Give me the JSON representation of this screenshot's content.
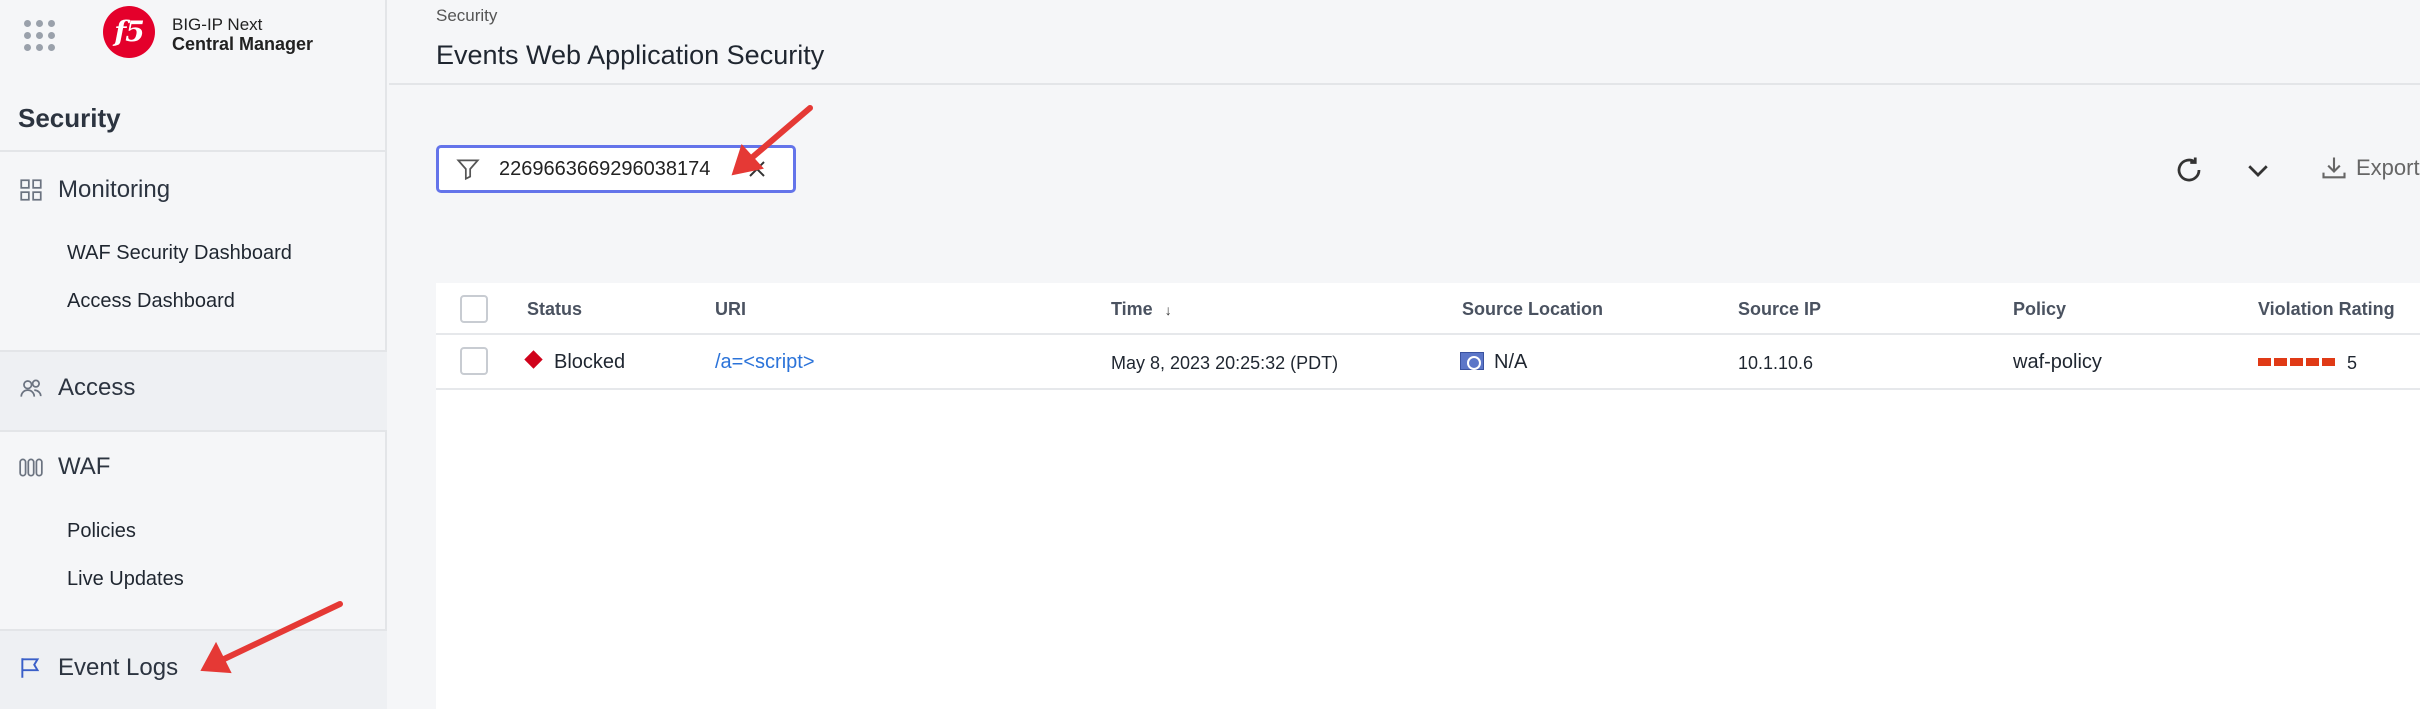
{
  "brand": {
    "line1": "BIG-IP Next",
    "line2": "Central Manager",
    "logo_text": "f5",
    "logo_color": "#e4002b"
  },
  "sidebar": {
    "section_title": "Security",
    "groups": [
      {
        "label": "Monitoring",
        "icon": "grid-icon",
        "items": [
          "WAF Security Dashboard",
          "Access Dashboard"
        ]
      },
      {
        "label": "Access",
        "icon": "users-icon",
        "items": []
      },
      {
        "label": "WAF",
        "icon": "waf-icon",
        "items": [
          "Policies",
          "Live Updates"
        ]
      },
      {
        "label": "Event Logs",
        "icon": "flag-icon",
        "items": []
      }
    ]
  },
  "header": {
    "breadcrumb": "Security",
    "title": "Events Web Application Security"
  },
  "filter": {
    "value": "2269663669296038174",
    "accent": "#6474ea"
  },
  "toolbar": {
    "refresh_icon": "refresh-icon",
    "expand_icon": "chevron-down-icon",
    "export_label": "Export"
  },
  "table": {
    "columns": [
      "Status",
      "URI",
      "Time",
      "Source Location",
      "Source IP",
      "Policy",
      "Violation Rating"
    ],
    "sort_column": "Time",
    "rows": [
      {
        "status": "Blocked",
        "uri": "/a=<script>",
        "time": "May 8, 2023 20:25:32 (PDT)",
        "source_location": "N/A",
        "source_ip": "10.1.10.6",
        "policy": "waf-policy",
        "violation_rating": "5"
      }
    ]
  },
  "colors": {
    "blocked": "#d0021b",
    "link": "#2b73d9",
    "rating": "#e03a16",
    "annotation_arrow": "#e53935"
  }
}
